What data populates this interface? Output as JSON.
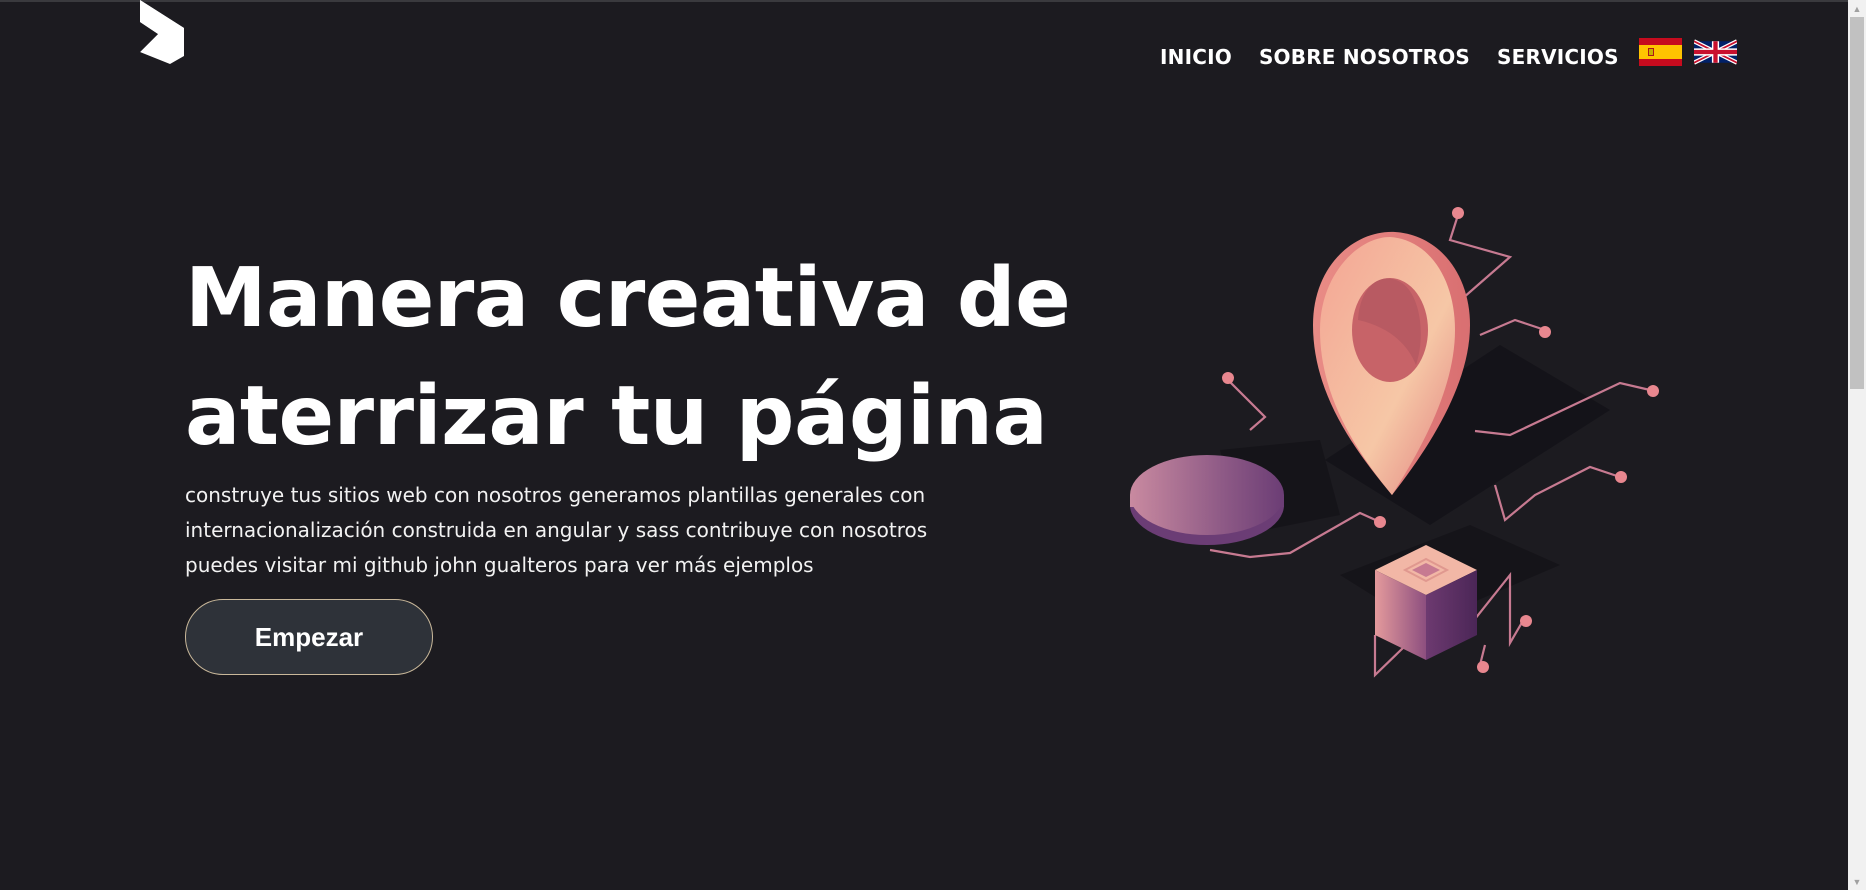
{
  "nav": {
    "items": [
      "INICIO",
      "SOBRE NOSOTROS",
      "SERVICIOS"
    ],
    "flags": [
      "spanish-flag",
      "english-flag"
    ]
  },
  "hero": {
    "title_line1": "Manera creativa de",
    "title_line2": "aterrizar tu página",
    "description": "construye tus sitios web con nosotros generamos plantillas generales con internacionalización construida en angular y sass contribuye con nosotros puedes visitar mi github john gualteros para ver más ejemplos",
    "cta_label": "Empezar"
  },
  "colors": {
    "background": "#1c1b20",
    "button_bg": "#2e3239",
    "button_border": "#c9b89a",
    "accent_pink": "#e88a8a",
    "accent_purple": "#6b3d75"
  }
}
